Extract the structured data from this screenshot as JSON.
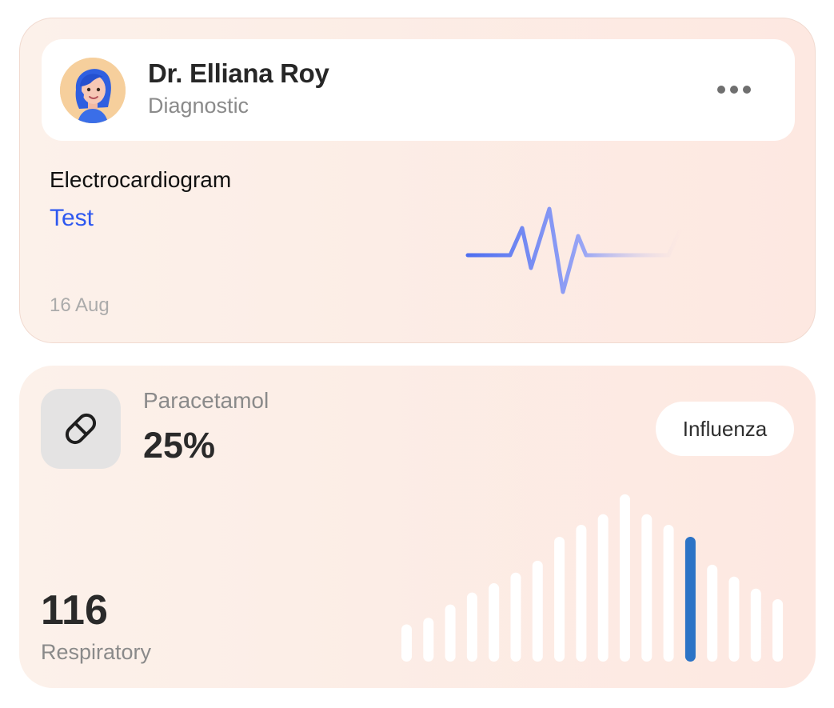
{
  "doctor": {
    "name": "Dr. Elliana Roy",
    "role": "Diagnostic",
    "avatar_icon": "memoji-avatar",
    "more_icon": "more-horizontal-icon"
  },
  "test": {
    "title": "Electrocardiogram",
    "link_label": "Test",
    "date": "16 Aug",
    "link_color": "#2e58f0"
  },
  "medication": {
    "icon": "pill-icon",
    "name": "Paracetamol",
    "value": "25%",
    "tag": "Influenza"
  },
  "respiratory": {
    "value": "116",
    "label": "Respiratory",
    "bar_levels": [
      0.28,
      0.33,
      0.43,
      0.52,
      0.59,
      0.67,
      0.76,
      0.94,
      1.03,
      1.11,
      1.26,
      1.11,
      1.03,
      0.94,
      0.73,
      0.64,
      0.55,
      0.47
    ],
    "highlight_index": 13,
    "highlight_color": "#2b73c6",
    "bar_color": "#ffffff"
  }
}
